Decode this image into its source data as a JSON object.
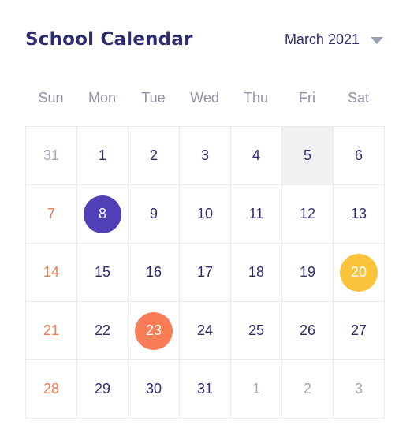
{
  "header": {
    "title": "School Calendar",
    "month_label": "March 2021"
  },
  "weekdays": [
    "Sun",
    "Mon",
    "Tue",
    "Wed",
    "Thu",
    "Fri",
    "Sat"
  ],
  "colors": {
    "title": "#2b2d6e",
    "sunday": "#f0794d",
    "outside_month": "#a2a5b5",
    "selected_purple": "#5040b8",
    "selected_yellow": "#f9c33c",
    "selected_orange": "#f87c56",
    "today_background": "#f1f1f3"
  },
  "weeks": [
    [
      {
        "day": "31",
        "outside": true
      },
      {
        "day": "1"
      },
      {
        "day": "2"
      },
      {
        "day": "3"
      },
      {
        "day": "4"
      },
      {
        "day": "5",
        "highlight": true
      },
      {
        "day": "6"
      }
    ],
    [
      {
        "day": "7"
      },
      {
        "day": "8",
        "marker": "purple"
      },
      {
        "day": "9"
      },
      {
        "day": "10"
      },
      {
        "day": "11"
      },
      {
        "day": "12"
      },
      {
        "day": "13"
      }
    ],
    [
      {
        "day": "14"
      },
      {
        "day": "15"
      },
      {
        "day": "16"
      },
      {
        "day": "17"
      },
      {
        "day": "18"
      },
      {
        "day": "19"
      },
      {
        "day": "20",
        "marker": "yellow"
      }
    ],
    [
      {
        "day": "21"
      },
      {
        "day": "22"
      },
      {
        "day": "23",
        "marker": "orange"
      },
      {
        "day": "24"
      },
      {
        "day": "25"
      },
      {
        "day": "26"
      },
      {
        "day": "27"
      }
    ],
    [
      {
        "day": "28"
      },
      {
        "day": "29"
      },
      {
        "day": "30"
      },
      {
        "day": "31"
      },
      {
        "day": "1",
        "outside": true
      },
      {
        "day": "2",
        "outside": true
      },
      {
        "day": "3",
        "outside": true
      }
    ]
  ]
}
